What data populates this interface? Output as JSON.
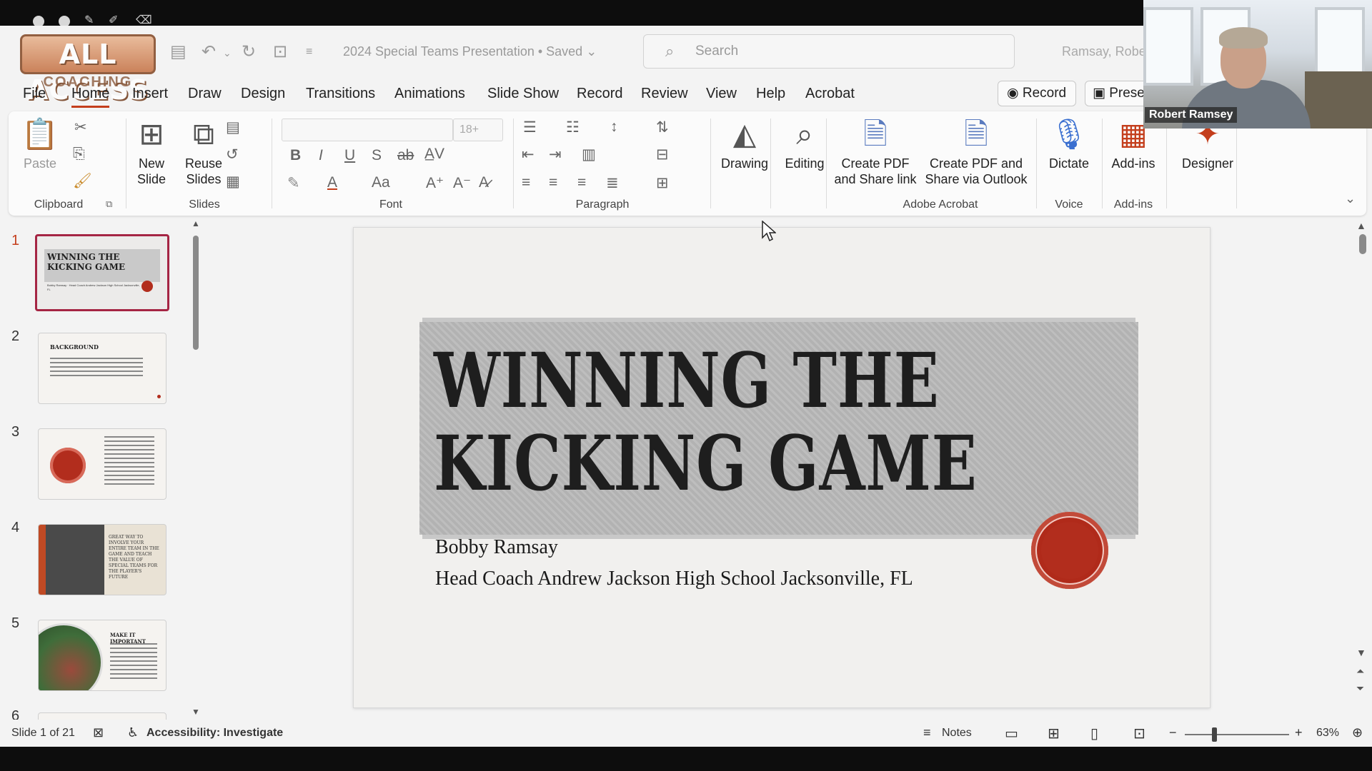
{
  "title_bar": {
    "logo_text": "ALL ACCESS",
    "logo_sub": "COACHING",
    "doc_title": "2024 Special Teams Presentation • Saved",
    "search_placeholder": "Search",
    "user_name": "Ramsay, Robe"
  },
  "menu": {
    "items": [
      "File",
      "Home",
      "Insert",
      "Draw",
      "Design",
      "Transitions",
      "Animations",
      "Slide Show",
      "Record",
      "Review",
      "View",
      "Help",
      "Acrobat"
    ],
    "active": "Home",
    "record_label": "Record",
    "present_label": "Prese"
  },
  "ribbon": {
    "clipboard": {
      "paste": "Paste",
      "label": "Clipboard"
    },
    "slides": {
      "new_slide": "New Slide",
      "reuse_slides": "Reuse Slides",
      "label": "Slides"
    },
    "font": {
      "font_size": "18+",
      "label": "Font"
    },
    "paragraph": {
      "label": "Paragraph"
    },
    "drawing": "Drawing",
    "editing": "Editing",
    "acrobat": {
      "create_pdf_share_link": "Create PDF and Share link",
      "create_pdf_outlook": "Create PDF and Share via Outlook",
      "label": "Adobe Acrobat"
    },
    "voice": {
      "dictate": "Dictate",
      "label": "Voice"
    },
    "addins": {
      "addins": "Add-ins",
      "label": "Add-ins"
    },
    "designer": "Designer"
  },
  "thumbnails": [
    {
      "num": "1",
      "title": "WINNING THE KICKING GAME",
      "text": "Bobby Ramsay · Head Coach Andrew Jackson High School Jacksonville, FL"
    },
    {
      "num": "2",
      "title": "BACKGROUND",
      "text": ""
    },
    {
      "num": "3",
      "title": "",
      "text": ""
    },
    {
      "num": "4",
      "title": "GREAT WAY TO INVOLVE YOUR ENTIRE TEAM IN THE GAME AND TEACH THE VALUE OF SPECIAL TEAMS FOR THE PLAYER'S FUTURE",
      "text": ""
    },
    {
      "num": "5",
      "title": "MAKE IT IMPORTANT",
      "text": ""
    },
    {
      "num": "6",
      "title": "",
      "text": ""
    }
  ],
  "slide": {
    "title": "WINNING THE KICKING GAME",
    "line1": "Bobby Ramsay",
    "line2": "Head Coach Andrew Jackson High School Jacksonville, FL"
  },
  "status": {
    "slide_info": "Slide 1 of 21",
    "accessibility": "Accessibility: Investigate",
    "notes": "Notes",
    "zoom": "63%"
  },
  "webcam": {
    "name": "Robert Ramsey"
  },
  "colors": {
    "accent": "#c43e1c",
    "selected_border": "#a52544",
    "seal": "#b22d1d"
  }
}
